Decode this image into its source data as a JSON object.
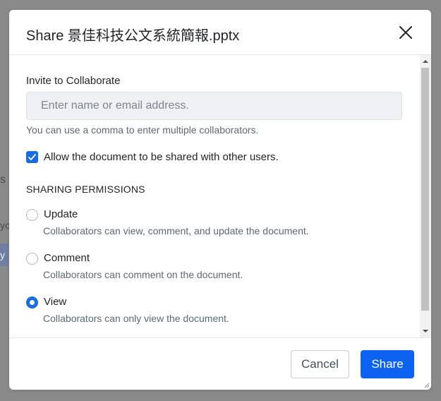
{
  "background": {
    "fragment_s": "s",
    "fragment_yo": "yo",
    "fragment_btn": "y"
  },
  "dialog": {
    "title": "Share 景佳科技公文系統簡報.pptx",
    "close_icon": "close-icon"
  },
  "invite": {
    "label": "Invite to Collaborate",
    "placeholder": "Enter name or email address.",
    "value": "",
    "help": "You can use a comma to enter multiple collaborators."
  },
  "allow_sharing": {
    "checked": true,
    "label": "Allow the document to be shared with other users."
  },
  "permissions": {
    "heading": "SHARING PERMISSIONS",
    "selected": "View",
    "options": [
      {
        "label": "Update",
        "description": "Collaborators can view, comment, and update the document.",
        "checked": false
      },
      {
        "label": "Comment",
        "description": "Collaborators can comment on the document.",
        "checked": false
      },
      {
        "label": "View",
        "description": "Collaborators can only view the document.",
        "checked": true
      }
    ]
  },
  "footer": {
    "cancel_label": "Cancel",
    "share_label": "Share"
  },
  "colors": {
    "accent": "#0d63f0",
    "checkbox": "#1a6dde",
    "overlay": "#8a8a8a"
  }
}
